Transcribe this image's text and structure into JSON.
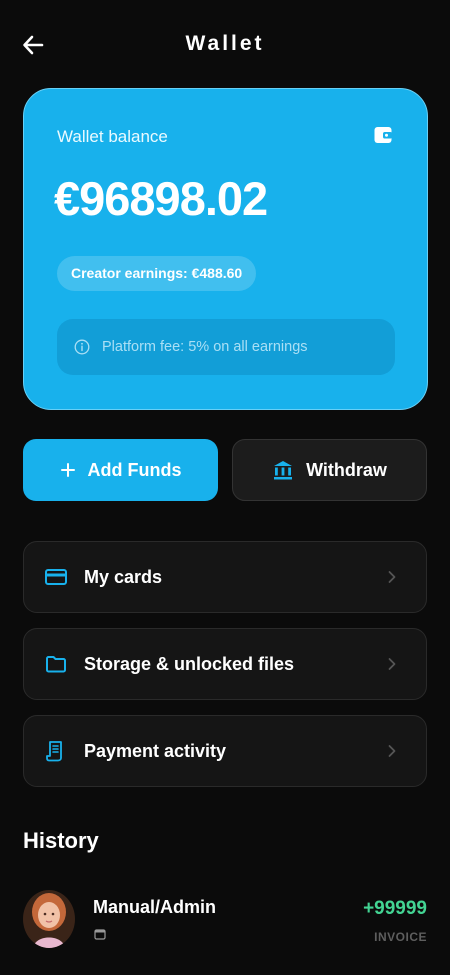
{
  "header": {
    "title": "Wallet",
    "back_icon": "arrow-left-icon"
  },
  "balance": {
    "label": "Wallet balance",
    "amount": "€96898.02",
    "earnings": "Creator earnings: €488.60",
    "fee": "Platform fee: 5% on all earnings",
    "icon": "wallet-icon"
  },
  "actions": {
    "add_funds": "Add Funds",
    "withdraw": "Withdraw"
  },
  "menu": [
    {
      "label": "My cards",
      "icon": "credit-card-icon"
    },
    {
      "label": "Storage & unlocked files",
      "icon": "folder-icon"
    },
    {
      "label": "Payment activity",
      "icon": "receipt-icon"
    }
  ],
  "history": {
    "title": "History",
    "items": [
      {
        "title": "Manual/Admin",
        "amount": "+99999",
        "type": "INVOICE"
      }
    ]
  },
  "colors": {
    "accent": "#18b1ec",
    "background": "#0b0b0b",
    "positive": "#43d493",
    "card": "#151515"
  }
}
